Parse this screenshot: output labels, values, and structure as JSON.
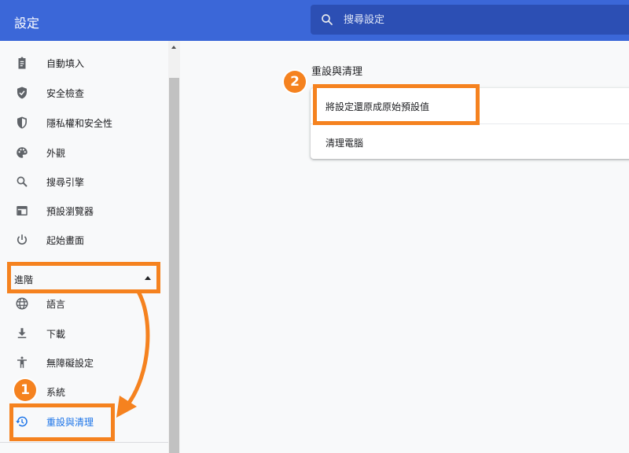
{
  "header": {
    "title": "設定",
    "search_placeholder": "搜尋設定"
  },
  "sidebar": {
    "items": [
      {
        "label": "自動填入",
        "icon": "clipboard-icon"
      },
      {
        "label": "安全檢查",
        "icon": "shield-check-icon"
      },
      {
        "label": "隱私權和安全性",
        "icon": "privacy-shield-icon"
      },
      {
        "label": "外觀",
        "icon": "palette-icon"
      },
      {
        "label": "搜尋引擎",
        "icon": "search-icon"
      },
      {
        "label": "預設瀏覽器",
        "icon": "browser-window-icon"
      },
      {
        "label": "起始畫面",
        "icon": "power-icon"
      }
    ],
    "advanced": {
      "label": "進階",
      "state": "expanded"
    },
    "advanced_items": [
      {
        "label": "語言",
        "icon": "globe-icon"
      },
      {
        "label": "下載",
        "icon": "download-icon"
      },
      {
        "label": "無障礙設定",
        "icon": "accessibility-icon"
      },
      {
        "label": "系統",
        "icon": "wrench-icon"
      },
      {
        "label": "重設與清理",
        "icon": "restore-icon",
        "active": true
      }
    ]
  },
  "main": {
    "section_title": "重設與清理",
    "rows": [
      {
        "label": "將設定還原成原始預設值"
      },
      {
        "label": "清理電腦"
      }
    ]
  },
  "annotations": {
    "step1": "1",
    "step2": "2",
    "color": "#f5821f"
  },
  "colors": {
    "header": "#3b67d8",
    "search": "#2c4fb4",
    "active": "#1a73e8"
  }
}
